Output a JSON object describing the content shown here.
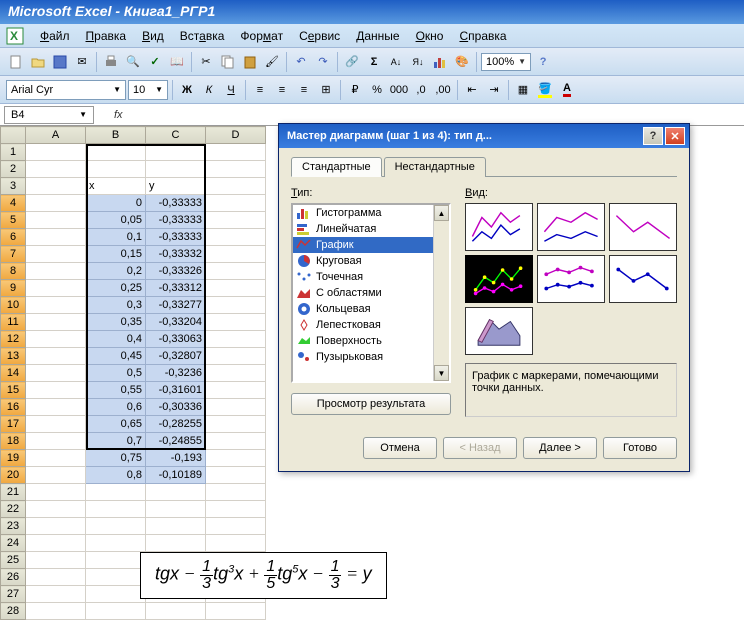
{
  "title": "Microsoft Excel - Книга1_РГР1",
  "menu": [
    "Файл",
    "Правка",
    "Вид",
    "Вставка",
    "Формат",
    "Сервис",
    "Данные",
    "Окно",
    "Справка"
  ],
  "zoom": "100%",
  "font": "Arial Cyr",
  "fontsize": "10",
  "cellref": "B4",
  "columns": [
    "A",
    "B",
    "C",
    "D"
  ],
  "rows": [
    "1",
    "2",
    "3",
    "4",
    "5",
    "6",
    "7",
    "8",
    "9",
    "10",
    "11",
    "12",
    "13",
    "14",
    "15",
    "16",
    "17",
    "18",
    "19",
    "20",
    "21",
    "22",
    "23",
    "24",
    "25",
    "26",
    "27",
    "28"
  ],
  "headers": {
    "b": "x",
    "c": "y"
  },
  "data": [
    {
      "x": "0",
      "y": "-0,33333"
    },
    {
      "x": "0,05",
      "y": "-0,33333"
    },
    {
      "x": "0,1",
      "y": "-0,33333"
    },
    {
      "x": "0,15",
      "y": "-0,33332"
    },
    {
      "x": "0,2",
      "y": "-0,33326"
    },
    {
      "x": "0,25",
      "y": "-0,33312"
    },
    {
      "x": "0,3",
      "y": "-0,33277"
    },
    {
      "x": "0,35",
      "y": "-0,33204"
    },
    {
      "x": "0,4",
      "y": "-0,33063"
    },
    {
      "x": "0,45",
      "y": "-0,32807"
    },
    {
      "x": "0,5",
      "y": "-0,3236"
    },
    {
      "x": "0,55",
      "y": "-0,31601"
    },
    {
      "x": "0,6",
      "y": "-0,30336"
    },
    {
      "x": "0,65",
      "y": "-0,28255"
    },
    {
      "x": "0,7",
      "y": "-0,24855"
    },
    {
      "x": "0,75",
      "y": "-0,193"
    },
    {
      "x": "0,8",
      "y": "-0,10189"
    }
  ],
  "dialog": {
    "title": "Мастер диаграмм (шаг 1 из 4): тип д...",
    "tabs": [
      "Стандартные",
      "Нестандартные"
    ],
    "type_label": "Тип:",
    "view_label": "Вид:",
    "types": [
      "Гистограмма",
      "Линейчатая",
      "График",
      "Круговая",
      "Точечная",
      "С областями",
      "Кольцевая",
      "Лепестковая",
      "Поверхность",
      "Пузырьковая"
    ],
    "selected_type": 2,
    "desc": "График с маркерами, помечающими точки данных.",
    "preview_btn": "Просмотр результата",
    "buttons": {
      "cancel": "Отмена",
      "back": "< Назад",
      "next": "Далее >",
      "finish": "Готово"
    }
  },
  "formula": "tgx − ⅓tg³x + ⅕tg⁵x − ⅓ = y"
}
